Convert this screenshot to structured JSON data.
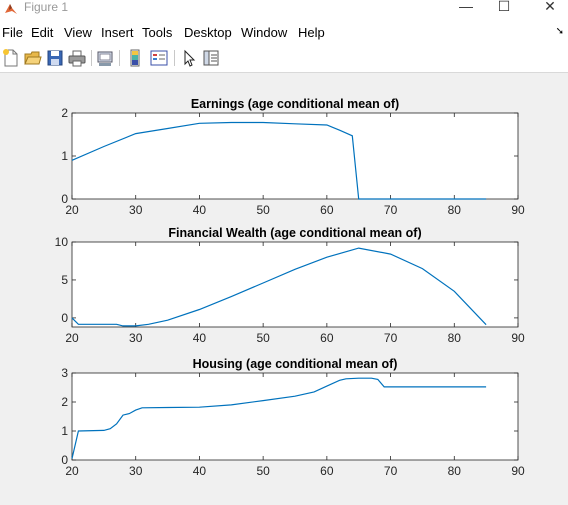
{
  "window": {
    "title": "Figure 1",
    "minimize": "—",
    "maximize": "☐",
    "close": "✕"
  },
  "menu": [
    "File",
    "Edit",
    "View",
    "Insert",
    "Tools",
    "Desktop",
    "Window",
    "Help"
  ],
  "menu_pin": "➘",
  "toolbar": [
    "new-figure",
    "open-file",
    "save",
    "print",
    "link-plot",
    "insert-colorbar",
    "insert-legend",
    "edit-plot",
    "property-inspector"
  ],
  "colors": {
    "line": "#0072bd",
    "axes_bg": "#ffffff"
  },
  "chart_data": [
    {
      "type": "line",
      "title": "Earnings (age conditional mean of)",
      "xlim": [
        20,
        90
      ],
      "ylim": [
        0,
        2
      ],
      "xticks": [
        20,
        30,
        40,
        50,
        60,
        70,
        80,
        90
      ],
      "yticks": [
        0,
        1,
        2
      ],
      "series": [
        {
          "x": [
            20,
            25,
            30,
            35,
            40,
            45,
            50,
            55,
            60,
            62,
            64,
            65,
            66,
            70,
            75,
            80,
            85
          ],
          "y": [
            0.9,
            1.22,
            1.52,
            1.64,
            1.76,
            1.78,
            1.78,
            1.75,
            1.72,
            1.6,
            1.47,
            0.0,
            0.0,
            0.0,
            0.0,
            0.0,
            0.0
          ]
        }
      ]
    },
    {
      "type": "line",
      "title": "Financial Wealth (age conditional mean of)",
      "xlim": [
        20,
        90
      ],
      "ylim": [
        -1.2,
        10
      ],
      "xticks": [
        20,
        30,
        40,
        50,
        60,
        70,
        80,
        90
      ],
      "yticks": [
        0,
        5,
        10
      ],
      "series": [
        {
          "x": [
            20,
            21,
            27,
            28,
            30,
            32,
            35,
            40,
            45,
            50,
            55,
            60,
            65,
            70,
            75,
            80,
            85
          ],
          "y": [
            0.0,
            -0.85,
            -0.85,
            -1.05,
            -1.05,
            -0.85,
            -0.3,
            1.1,
            2.8,
            4.6,
            6.4,
            8.0,
            9.2,
            8.4,
            6.5,
            3.5,
            -0.9
          ]
        }
      ]
    },
    {
      "type": "line",
      "title": "Housing (age conditional mean of)",
      "xlim": [
        20,
        90
      ],
      "ylim": [
        0,
        3
      ],
      "xticks": [
        20,
        30,
        40,
        50,
        60,
        70,
        80,
        90
      ],
      "yticks": [
        0,
        1,
        2,
        3
      ],
      "series": [
        {
          "x": [
            20,
            21,
            25,
            26,
            27,
            28,
            29,
            30,
            31,
            35,
            40,
            45,
            50,
            55,
            58,
            60,
            62,
            63,
            65,
            67,
            68,
            69,
            70,
            75,
            80,
            85
          ],
          "y": [
            0.05,
            1.0,
            1.02,
            1.08,
            1.25,
            1.55,
            1.6,
            1.72,
            1.8,
            1.81,
            1.82,
            1.9,
            2.05,
            2.2,
            2.35,
            2.55,
            2.75,
            2.8,
            2.82,
            2.82,
            2.78,
            2.52,
            2.52,
            2.52,
            2.52,
            2.52
          ]
        }
      ]
    }
  ]
}
